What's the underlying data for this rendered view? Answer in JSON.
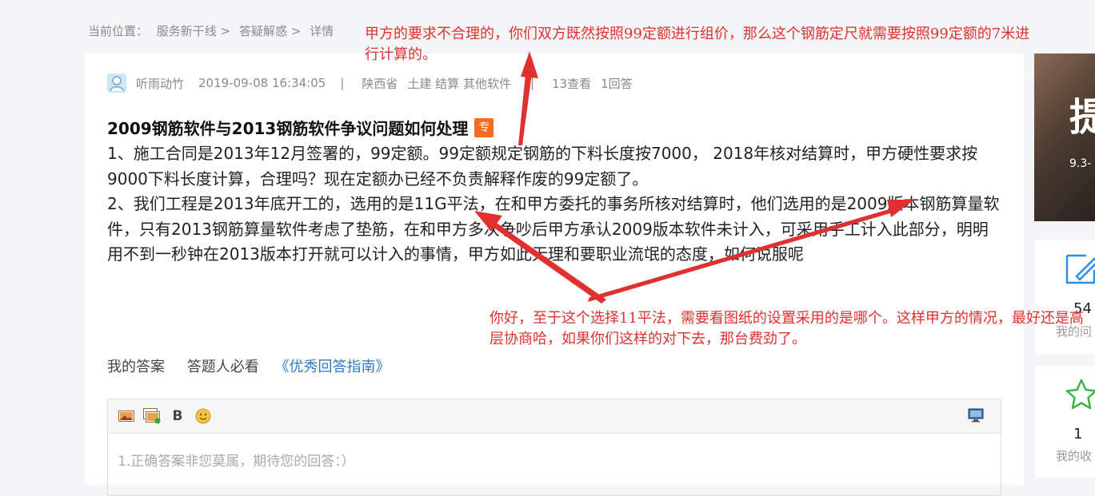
{
  "breadcrumb": {
    "label": "当前位置：",
    "home": "服务新干线",
    "sep1": ">",
    "section": "答疑解惑",
    "sep2": ">",
    "current": "详情"
  },
  "question": {
    "author": "听雨动竹",
    "datetime": "2019-09-08 16:34:05",
    "sep": "|",
    "region": "陕西省",
    "tags": "土建 结算 其他软件",
    "views": "13查看",
    "answers": "1回答",
    "title": "2009钢筋软件与2013钢筋软件争议问题如何处理",
    "badge": "专",
    "body": [
      " 1、施工合同是2013年12月签署的，99定额。99定额规定钢筋的下料长度按7000， 2018年核对结算时，甲方硬性要求按9000下料长度计算，合理吗？现在定额办已经不负责解释作废的99定额了。",
      "2、我们工程是2013年底开工的，选用的是11G平法，在和甲方委托的事务所核对结算时，他们选用的是2009版本钢筋算量软件，只有2013钢筋算量软件考虑了垫筋，在和甲方多次争吵后甲方承认2009版本软件未计入，可采用手工计入此部分，明明用不到一秒钟在2013版本打开就可以计入的事情，甲方如此无理和要职业流氓的态度，如何说服呢"
    ]
  },
  "answer_section": {
    "my_answer": "我的答案",
    "must_read": "答题人必看",
    "guide_link": "《优秀回答指南》",
    "placeholder": "1.正确答案非您莫属，期待您的回答：）",
    "bold_label": "B"
  },
  "annotations": {
    "top": "甲方的要求不合理的，你们双方既然按照99定额进行组价，那么这个钢筋定尺就需要按照99定额的7米进行计算的。",
    "bottom": "你好，至于这个选择11平法，需要看图纸的设置采用的是哪个。这样甲方的情况，最好还是高层协商哈，如果你们这样的对下去，那台费劲了。",
    "color": "#e03030"
  },
  "sidebar": {
    "banner_char": "提",
    "banner_date": "9.3-",
    "questions_count": "54",
    "questions_label": "我的问",
    "favorites_count": "1",
    "favorites_label": "我的收"
  }
}
